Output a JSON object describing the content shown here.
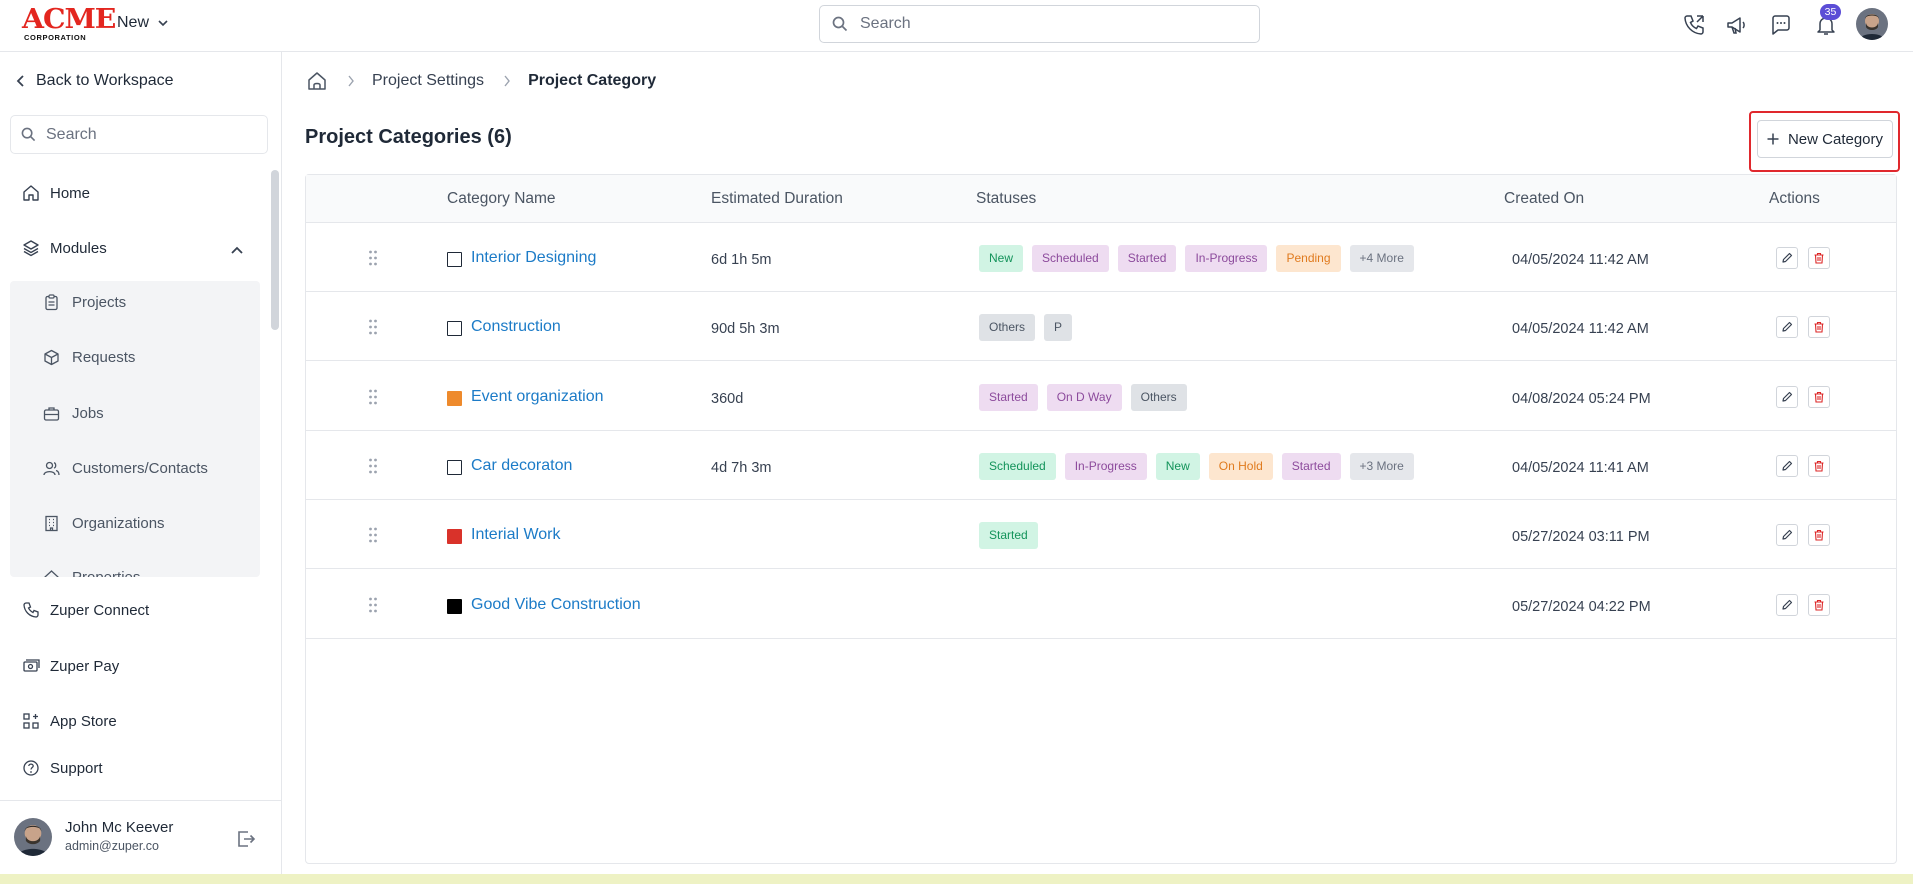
{
  "header": {
    "logo_text": "ACME",
    "logo_subtext": "CORPORATION",
    "new_label": "New",
    "search_placeholder": "Search",
    "notification_count": "35"
  },
  "sidebar": {
    "back_label": "Back to Workspace",
    "search_placeholder": "Search",
    "home_label": "Home",
    "modules_label": "Modules",
    "modules_items": [
      {
        "label": "Projects",
        "icon": "clipboard-icon"
      },
      {
        "label": "Requests",
        "icon": "box-icon"
      },
      {
        "label": "Jobs",
        "icon": "briefcase-icon"
      },
      {
        "label": "Customers/Contacts",
        "icon": "users-icon"
      },
      {
        "label": "Organizations",
        "icon": "building-icon"
      },
      {
        "label": "Properties",
        "icon": "property-icon"
      }
    ],
    "bottom_items": [
      {
        "label": "Zuper Connect",
        "icon": "phone-icon"
      },
      {
        "label": "Zuper Pay",
        "icon": "money-icon"
      },
      {
        "label": "App Store",
        "icon": "apps-grid-icon"
      },
      {
        "label": "Support",
        "icon": "help-circle-icon"
      }
    ],
    "user": {
      "name": "John Mc Keever",
      "email": "admin@zuper.co"
    }
  },
  "breadcrumb": {
    "items": [
      "Project Settings",
      "Project Category"
    ]
  },
  "page": {
    "title": "Project Categories (6)",
    "new_category_label": "New Category"
  },
  "table": {
    "columns": [
      "Category Name",
      "Estimated Duration",
      "Statuses",
      "Created On",
      "Actions"
    ],
    "rows": [
      {
        "name": "Interior Designing",
        "color": "",
        "duration": "6d 1h 5m",
        "statuses": [
          {
            "label": "New",
            "bg": "#d1f4e4",
            "fg": "#13935a"
          },
          {
            "label": "Scheduled",
            "bg": "#eedcf1",
            "fg": "#8c4a9c"
          },
          {
            "label": "Started",
            "bg": "#eedcf1",
            "fg": "#8c4a9c"
          },
          {
            "label": "In-Progress",
            "bg": "#eedcf1",
            "fg": "#8c4a9c"
          },
          {
            "label": "Pending",
            "bg": "#fde6cf",
            "fg": "#e07b1f"
          },
          {
            "label": "+4 More",
            "bg": "#e5e7eb",
            "fg": "#6b7280"
          }
        ],
        "created": "04/05/2024 11:42 AM"
      },
      {
        "name": "Construction",
        "color": "",
        "duration": "90d 5h 3m",
        "statuses": [
          {
            "label": "Others",
            "bg": "#dfe2e6",
            "fg": "#4b5563"
          },
          {
            "label": "P",
            "bg": "#dfe2e6",
            "fg": "#4b5563"
          }
        ],
        "created": "04/05/2024 11:42 AM"
      },
      {
        "name": "Event organization",
        "color": "#ee8a2c",
        "duration": "360d",
        "statuses": [
          {
            "label": "Started",
            "bg": "#eedcf1",
            "fg": "#8c4a9c"
          },
          {
            "label": "On D Way",
            "bg": "#eedcf1",
            "fg": "#8c4a9c"
          },
          {
            "label": "Others",
            "bg": "#dfe2e6",
            "fg": "#4b5563"
          }
        ],
        "created": "04/08/2024 05:24 PM"
      },
      {
        "name": "Car decoraton",
        "color": "",
        "duration": "4d 7h 3m",
        "statuses": [
          {
            "label": "Scheduled",
            "bg": "#d1f4e4",
            "fg": "#13935a"
          },
          {
            "label": "In-Progress",
            "bg": "#eedcf1",
            "fg": "#8c4a9c"
          },
          {
            "label": "New",
            "bg": "#d1f4e4",
            "fg": "#13935a"
          },
          {
            "label": "On Hold",
            "bg": "#fde6cf",
            "fg": "#e07b1f"
          },
          {
            "label": "Started",
            "bg": "#eedcf1",
            "fg": "#8c4a9c"
          },
          {
            "label": "+3 More",
            "bg": "#e5e7eb",
            "fg": "#6b7280"
          }
        ],
        "created": "04/05/2024 11:41 AM"
      },
      {
        "name": "Interial Work",
        "color": "#d9322a",
        "duration": "",
        "statuses": [
          {
            "label": "Started",
            "bg": "#d1f4e4",
            "fg": "#13935a"
          }
        ],
        "created": "05/27/2024 03:11 PM"
      },
      {
        "name": "Good Vibe Construction",
        "color": "#000000",
        "duration": "",
        "statuses": [],
        "created": "05/27/2024 04:22 PM"
      }
    ]
  },
  "colors": {
    "link": "#1c7bc7",
    "brand_red": "#e3261f",
    "badge": "#5b4dd6",
    "highlight": "#e0282d",
    "delete": "#dc2626"
  }
}
